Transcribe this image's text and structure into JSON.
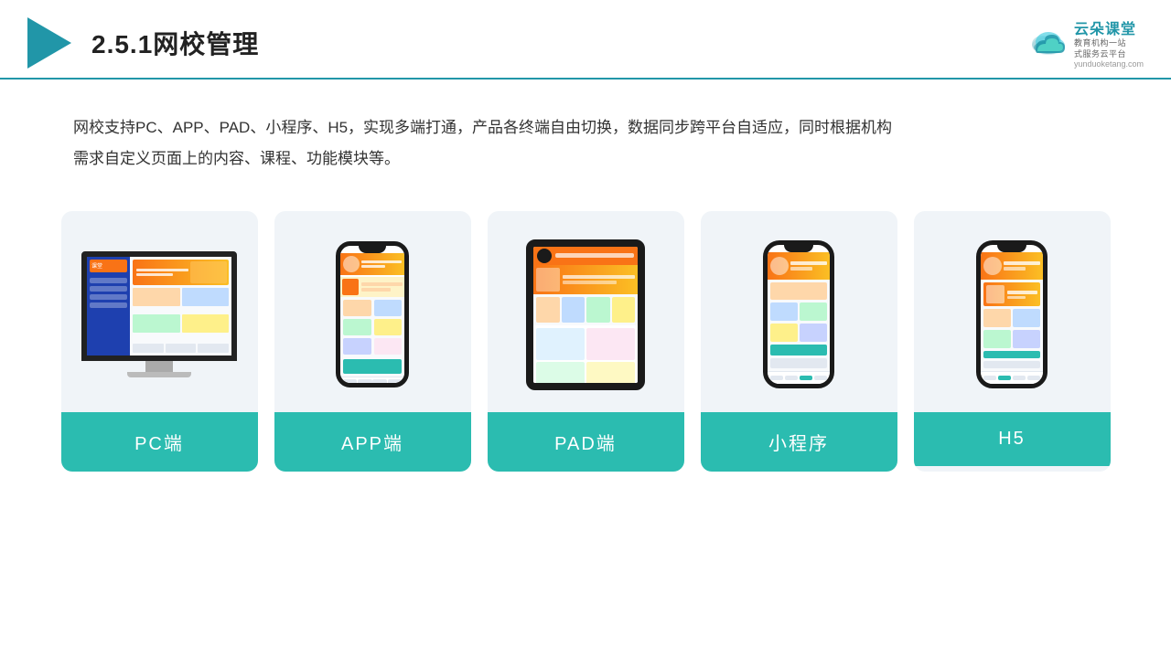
{
  "header": {
    "title": "2.5.1网校管理",
    "brand_name": "云朵课堂",
    "brand_sub1": "教育机构一站",
    "brand_sub2": "式服务云平台",
    "brand_url": "yunduoketang.com"
  },
  "description": {
    "text1": "网校支持PC、APP、PAD、小程序、H5，实现多端打通，产品各终端自由切换，数据同步跨平台自适应，同时根据机构",
    "text2": "需求自定义页面上的内容、课程、功能模块等。"
  },
  "cards": [
    {
      "id": "pc",
      "label": "PC端"
    },
    {
      "id": "app",
      "label": "APP端"
    },
    {
      "id": "pad",
      "label": "PAD端"
    },
    {
      "id": "miniprogram",
      "label": "小程序"
    },
    {
      "id": "h5",
      "label": "H5"
    }
  ],
  "colors": {
    "accent": "#2bbcb0",
    "header_line": "#2196a8",
    "triangle": "#2196a8"
  }
}
